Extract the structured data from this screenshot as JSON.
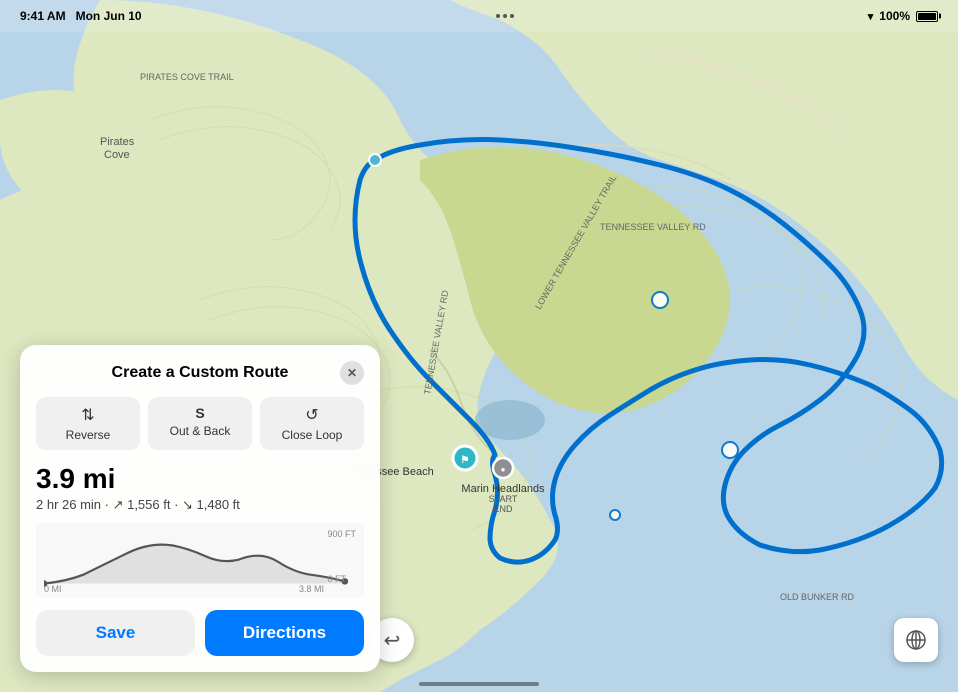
{
  "status_bar": {
    "time": "9:41 AM",
    "date": "Mon Jun 10",
    "wifi": "WiFi",
    "battery": "100%"
  },
  "map": {
    "location_pin_1": {
      "name": "Tennessee Beach",
      "type": "start"
    },
    "location_pin_2": {
      "name": "Marin Headlands",
      "type": "end",
      "start_label": "START",
      "end_label": "END"
    }
  },
  "panel": {
    "title": "Create a Custom Route",
    "close_label": "✕",
    "options": [
      {
        "icon": "⇅",
        "label": "Reverse"
      },
      {
        "icon": "S",
        "label": "Out & Back"
      },
      {
        "icon": "↺",
        "label": "Close Loop"
      }
    ],
    "distance": "3.9 mi",
    "details": "2 hr 26 min · ↗ 1,556 ft · ↘ 1,480 ft",
    "elevation_chart": {
      "top_label": "900 FT",
      "bottom_label": "0 FT",
      "start_mi": "0 MI",
      "end_mi": "3.8 MI"
    },
    "save_label": "Save",
    "directions_label": "Directions"
  },
  "buttons": {
    "undo_icon": "↩",
    "map_controls_icon": "⊕"
  }
}
